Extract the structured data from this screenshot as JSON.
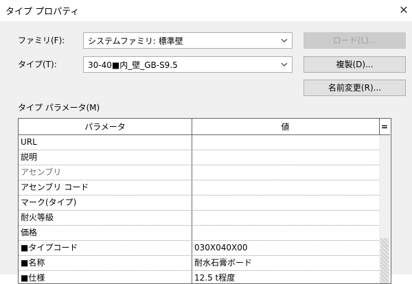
{
  "window": {
    "title": "タイプ プロパティ",
    "close_glyph": "✕"
  },
  "family": {
    "label": "ファミリ(F):",
    "value": "システムファミリ: 標準壁"
  },
  "type": {
    "label": "タイプ(T):",
    "value": "30-40■内_壁_GB-S9.5"
  },
  "buttons": {
    "load": "ロード(L)...",
    "duplicate": "複製(D)...",
    "rename": "名前変更(R)..."
  },
  "params": {
    "label": "タイプ パラメータ(M)",
    "header": {
      "param": "パラメータ",
      "value": "値",
      "extra": "="
    },
    "rows": [
      {
        "name": "URL",
        "value": "",
        "gray": false
      },
      {
        "name": "説明",
        "value": "",
        "gray": false
      },
      {
        "name": "アセンブリ",
        "value": "",
        "gray": true
      },
      {
        "name": "アセンブリ コード",
        "value": "",
        "gray": false
      },
      {
        "name": "マーク(タイプ)",
        "value": "",
        "gray": false
      },
      {
        "name": "耐火等級",
        "value": "",
        "gray": false
      },
      {
        "name": "価格",
        "value": "",
        "gray": false
      },
      {
        "name": "■タイプコード",
        "value": "030X040X00",
        "gray": false
      },
      {
        "name": "■名称",
        "value": "耐水石膏ボード",
        "gray": false
      },
      {
        "name": "■仕様",
        "value": "12.5 t程度",
        "gray": false
      }
    ]
  },
  "colors": {
    "dialog_bg": "#f0f0f0",
    "disabled_text": "#a0a0a0",
    "grid_border": "#646464"
  },
  "icons": {
    "combo": "chevron-down-icon",
    "close": "close-icon"
  }
}
